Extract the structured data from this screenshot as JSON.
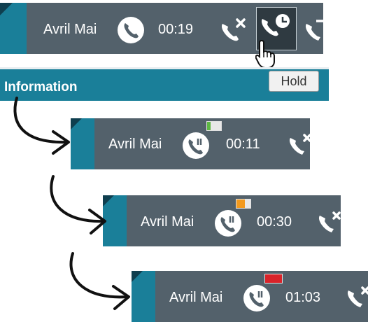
{
  "top_toolbar": {
    "contact_name": "Avril Mai",
    "call_timer": "00:19",
    "hold_tooltip": "Hold",
    "section_label": "Information"
  },
  "sequence": [
    {
      "contact_name": "Avril Mai",
      "call_timer": "00:11",
      "hold_status_color": "#5db843"
    },
    {
      "contact_name": "Avril Mai",
      "call_timer": "00:30",
      "hold_status_color": "#f39a1e"
    },
    {
      "contact_name": "Avril Mai",
      "call_timer": "01:03",
      "hold_status_color": "#d9232a"
    }
  ],
  "colors": {
    "toolbar_bg": "#53616b",
    "accent": "#1a7f99",
    "hold_button_active": "#2f3a41"
  }
}
